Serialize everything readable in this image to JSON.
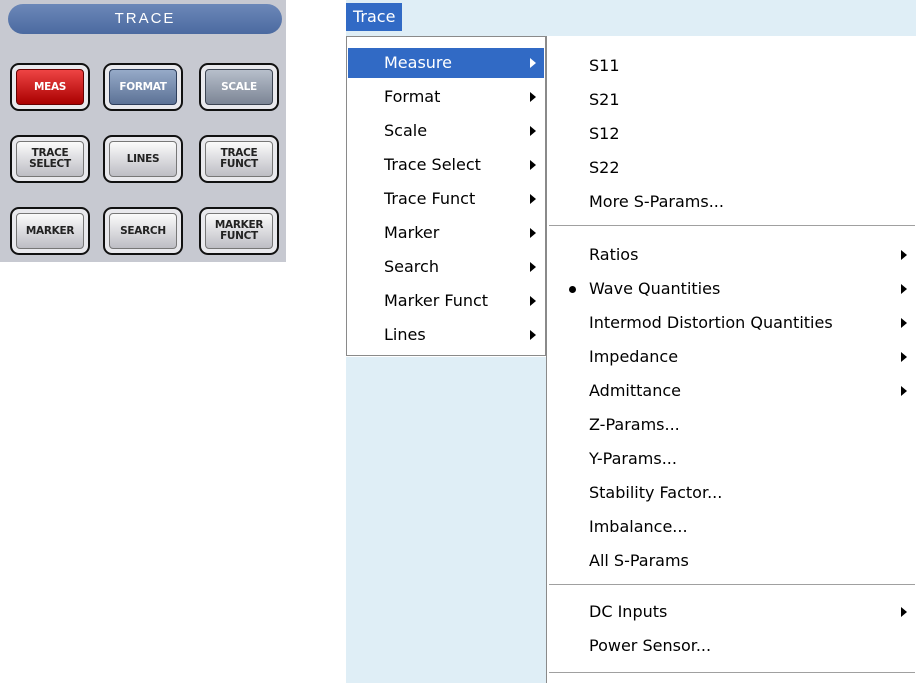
{
  "panel": {
    "title": "TRACE",
    "keys": {
      "meas": "MEAS",
      "format": "FORMAT",
      "scale": "SCALE",
      "trace_select": "TRACE\nSELECT",
      "lines": "LINES",
      "trace_funct": "TRACE\nFUNCT",
      "marker": "MARKER",
      "search": "SEARCH",
      "marker_funct": "MARKER\nFUNCT"
    },
    "colors": {
      "meas_active": "#cc1111",
      "panel_title": "#5877ab"
    }
  },
  "menubar": {
    "trace": "Trace"
  },
  "menu": [
    {
      "label": "Measure",
      "submenu": true,
      "highlighted": true
    },
    {
      "label": "Format",
      "submenu": true
    },
    {
      "label": "Scale",
      "submenu": true
    },
    {
      "label": "Trace Select",
      "submenu": true
    },
    {
      "label": "Trace Funct",
      "submenu": true
    },
    {
      "label": "Marker",
      "submenu": true
    },
    {
      "label": "Search",
      "submenu": true
    },
    {
      "label": "Marker Funct",
      "submenu": true
    },
    {
      "label": "Lines",
      "submenu": true
    }
  ],
  "submenu": [
    {
      "label": "S11"
    },
    {
      "label": "S21"
    },
    {
      "label": "S12"
    },
    {
      "label": "S22"
    },
    {
      "label": "More S-Params..."
    },
    {
      "label": "Ratios",
      "submenu": true
    },
    {
      "label": "Wave Quantities",
      "submenu": true,
      "selected": true
    },
    {
      "label": "Intermod Distortion Quantities",
      "submenu": true
    },
    {
      "label": "Impedance",
      "submenu": true
    },
    {
      "label": "Admittance",
      "submenu": true
    },
    {
      "label": "Z-Params..."
    },
    {
      "label": "Y-Params..."
    },
    {
      "label": "Stability Factor..."
    },
    {
      "label": "Imbalance..."
    },
    {
      "label": "All S-Params"
    },
    {
      "label": "DC Inputs",
      "submenu": true
    },
    {
      "label": "Power Sensor..."
    }
  ],
  "colors": {
    "highlight": "#316ac5",
    "background": "#dfeef6"
  }
}
